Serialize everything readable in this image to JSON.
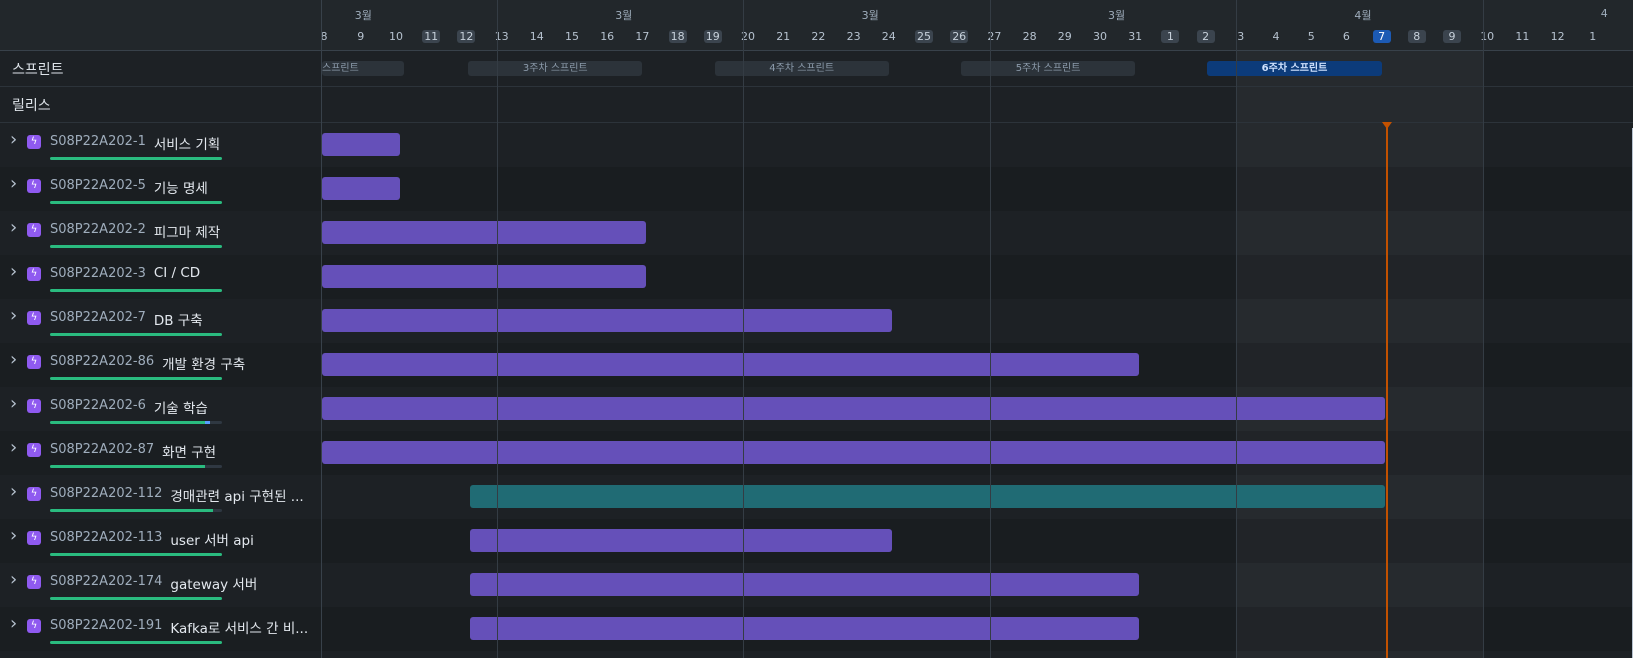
{
  "left_panel": {
    "sprint_label": "스프린트",
    "release_label": "릴리스",
    "issue_type_icon": "lightning-icon",
    "expand_icon": "chevron-right-icon",
    "issues": [
      {
        "key": "S08P22A202-1",
        "title": "서비스 기획",
        "progress": 1.0
      },
      {
        "key": "S08P22A202-5",
        "title": "기능 명세",
        "progress": 1.0
      },
      {
        "key": "S08P22A202-2",
        "title": "피그마 제작",
        "progress": 1.0
      },
      {
        "key": "S08P22A202-3",
        "title": "CI / CD",
        "progress": 1.0
      },
      {
        "key": "S08P22A202-7",
        "title": "DB 구축",
        "progress": 1.0
      },
      {
        "key": "S08P22A202-86",
        "title": "개발 환경 구축",
        "progress": 1.0
      },
      {
        "key": "S08P22A202-6",
        "title": "기술 학습",
        "progress": 0.9,
        "in_progress": 0.03
      },
      {
        "key": "S08P22A202-87",
        "title": "화면 구현",
        "progress": 0.9
      },
      {
        "key": "S08P22A202-112",
        "title": "경매관련 api 구현된 ...",
        "progress": 0.95
      },
      {
        "key": "S08P22A202-113",
        "title": "user 서버 api",
        "progress": 1.0
      },
      {
        "key": "S08P22A202-174",
        "title": "gateway 서버",
        "progress": 1.0
      },
      {
        "key": "S08P22A202-191",
        "title": "Kafka로 서비스 간 비...",
        "progress": 1.0
      }
    ]
  },
  "timeline": {
    "months": [
      "3월",
      "3월",
      "3월",
      "3월",
      "4월",
      "4"
    ],
    "days": [
      {
        "label": "8",
        "weekend": false
      },
      {
        "label": "9",
        "weekend": false
      },
      {
        "label": "10",
        "weekend": false
      },
      {
        "label": "11",
        "weekend": true
      },
      {
        "label": "12",
        "weekend": true
      },
      {
        "label": "13",
        "weekend": false
      },
      {
        "label": "14",
        "weekend": false
      },
      {
        "label": "15",
        "weekend": false
      },
      {
        "label": "16",
        "weekend": false
      },
      {
        "label": "17",
        "weekend": false
      },
      {
        "label": "18",
        "weekend": true
      },
      {
        "label": "19",
        "weekend": true
      },
      {
        "label": "20",
        "weekend": false
      },
      {
        "label": "21",
        "weekend": false
      },
      {
        "label": "22",
        "weekend": false
      },
      {
        "label": "23",
        "weekend": false
      },
      {
        "label": "24",
        "weekend": false
      },
      {
        "label": "25",
        "weekend": true
      },
      {
        "label": "26",
        "weekend": true
      },
      {
        "label": "27",
        "weekend": false
      },
      {
        "label": "28",
        "weekend": false
      },
      {
        "label": "29",
        "weekend": false
      },
      {
        "label": "30",
        "weekend": false
      },
      {
        "label": "31",
        "weekend": false
      },
      {
        "label": "1",
        "weekend": true
      },
      {
        "label": "2",
        "weekend": true
      },
      {
        "label": "3",
        "weekend": false
      },
      {
        "label": "4",
        "weekend": false
      },
      {
        "label": "5",
        "weekend": false
      },
      {
        "label": "6",
        "weekend": false
      },
      {
        "label": "7",
        "weekend": false,
        "today": true
      },
      {
        "label": "8",
        "weekend": true
      },
      {
        "label": "9",
        "weekend": true
      },
      {
        "label": "10",
        "weekend": false
      },
      {
        "label": "11",
        "weekend": false
      },
      {
        "label": "12",
        "weekend": false
      },
      {
        "label": "1",
        "weekend": false
      }
    ],
    "sprints": [
      {
        "name": "스프린트",
        "start": 0,
        "end": 2.55,
        "active": false
      },
      {
        "name": "3주차 스프린트",
        "start": 4.55,
        "end": 9.5,
        "active": false
      },
      {
        "name": "4주차 스프린트",
        "start": 11.55,
        "end": 16.5,
        "active": false
      },
      {
        "name": "5주차 스프린트",
        "start": 18.55,
        "end": 23.5,
        "active": false
      },
      {
        "name": "6주차 스프린트",
        "start": 25.55,
        "end": 30.5,
        "active": true
      }
    ],
    "today_index": 30,
    "bars": [
      {
        "start": 0,
        "end": 2.6,
        "color": "purple"
      },
      {
        "start": 0,
        "end": 2.6,
        "color": "purple"
      },
      {
        "start": 0,
        "end": 9.6,
        "color": "purple"
      },
      {
        "start": 0,
        "end": 9.6,
        "color": "purple"
      },
      {
        "start": 0,
        "end": 16.6,
        "color": "purple"
      },
      {
        "start": 0,
        "end": 23.6,
        "color": "purple"
      },
      {
        "start": 0,
        "end": 30.6,
        "color": "purple"
      },
      {
        "start": 0,
        "end": 30.6,
        "color": "purple"
      },
      {
        "start": 4.6,
        "end": 30.6,
        "color": "teal"
      },
      {
        "start": 4.6,
        "end": 16.6,
        "color": "purple"
      },
      {
        "start": 4.6,
        "end": 23.6,
        "color": "purple"
      },
      {
        "start": 4.6,
        "end": 23.6,
        "color": "purple"
      }
    ]
  },
  "colors": {
    "bar_purple": "#6550b9",
    "bar_teal": "#206b74",
    "today_line": "#c25100",
    "progress_done": "#2abb7f",
    "progress_active": "#579dff"
  }
}
